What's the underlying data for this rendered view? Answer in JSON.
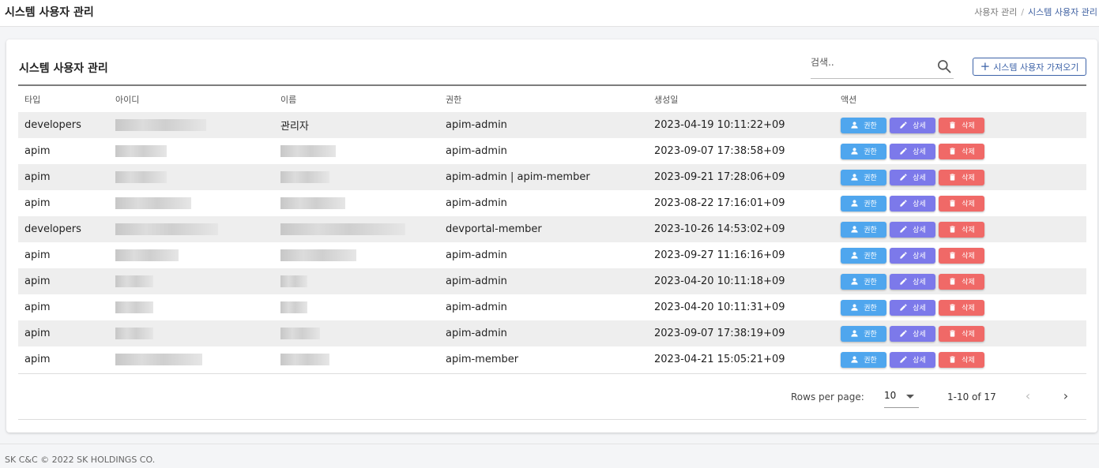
{
  "header": {
    "title": "시스템 사용자 관리",
    "breadcrumb": [
      "사용자 관리",
      "시스템 사용자 관리"
    ]
  },
  "card": {
    "title": "시스템 사용자 관리",
    "search_placeholder": "검색..",
    "import_button": "시스템 사용자 가져오기"
  },
  "table": {
    "columns": [
      "타입",
      "아이디",
      "이름",
      "권한",
      "생성일",
      "액션"
    ],
    "rows": [
      {
        "type": "developers",
        "id": "",
        "name": "관리자",
        "role": "apim-admin",
        "created": "2023-04-19 10:11:22+09"
      },
      {
        "type": "apim",
        "id": "",
        "name": "",
        "role": "apim-admin",
        "created": "2023-09-07 17:38:58+09"
      },
      {
        "type": "apim",
        "id": "",
        "name": "",
        "role": "apim-admin | apim-member",
        "created": "2023-09-21 17:28:06+09"
      },
      {
        "type": "apim",
        "id": "",
        "name": "",
        "role": "apim-admin",
        "created": "2023-08-22 17:16:01+09"
      },
      {
        "type": "developers",
        "id": "",
        "name": "",
        "role": "devportal-member",
        "created": "2023-10-26 14:53:02+09"
      },
      {
        "type": "apim",
        "id": "",
        "name": "",
        "role": "apim-admin",
        "created": "2023-09-27 11:16:16+09"
      },
      {
        "type": "apim",
        "id": "",
        "name": "",
        "role": "apim-admin",
        "created": "2023-04-20 10:11:18+09"
      },
      {
        "type": "apim",
        "id": "",
        "name": "",
        "role": "apim-admin",
        "created": "2023-04-20 10:11:31+09"
      },
      {
        "type": "apim",
        "id": "",
        "name": "",
        "role": "apim-admin",
        "created": "2023-09-07 17:38:19+09"
      },
      {
        "type": "apim",
        "id": "",
        "name": "",
        "role": "apim-member",
        "created": "2023-04-21 15:05:21+09"
      }
    ],
    "actions": {
      "permission": "권한",
      "detail": "상세",
      "delete": "삭제"
    }
  },
  "pagination": {
    "rows_per_page_label": "Rows per page:",
    "rows_per_page": "10",
    "range": "1-10 of 17"
  },
  "footer": "SK C&C © 2022 SK HOLDINGS CO.",
  "colors": {
    "permission_button": "#4fa6ee",
    "detail_button": "#7c79ea",
    "delete_button": "#f06967",
    "accent": "#3d63a8"
  },
  "icons": {
    "search": "search-icon",
    "import": "plus-icon",
    "permission": "user-icon",
    "detail": "pencil-icon",
    "delete": "trash-icon",
    "prev_page": "chevron-left-icon",
    "next_page": "chevron-right-icon"
  }
}
